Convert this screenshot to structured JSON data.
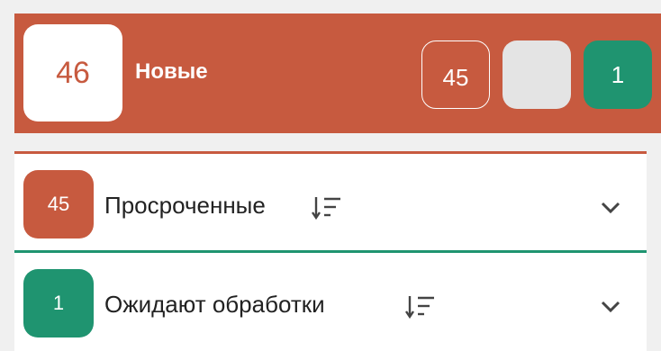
{
  "header": {
    "count": "46",
    "title": "Новые",
    "chips": {
      "outlined": "45",
      "grey": "",
      "green": "1"
    }
  },
  "groups": [
    {
      "count": "45",
      "label": "Просроченные"
    },
    {
      "count": "1",
      "label": "Ожидают обработки"
    }
  ],
  "colors": {
    "overdue": "#c75a3f",
    "pending": "#1f9470",
    "neutral": "#e4e4e4"
  },
  "icons": {
    "sort": "sort-descending-icon",
    "expand": "chevron-down-icon"
  }
}
